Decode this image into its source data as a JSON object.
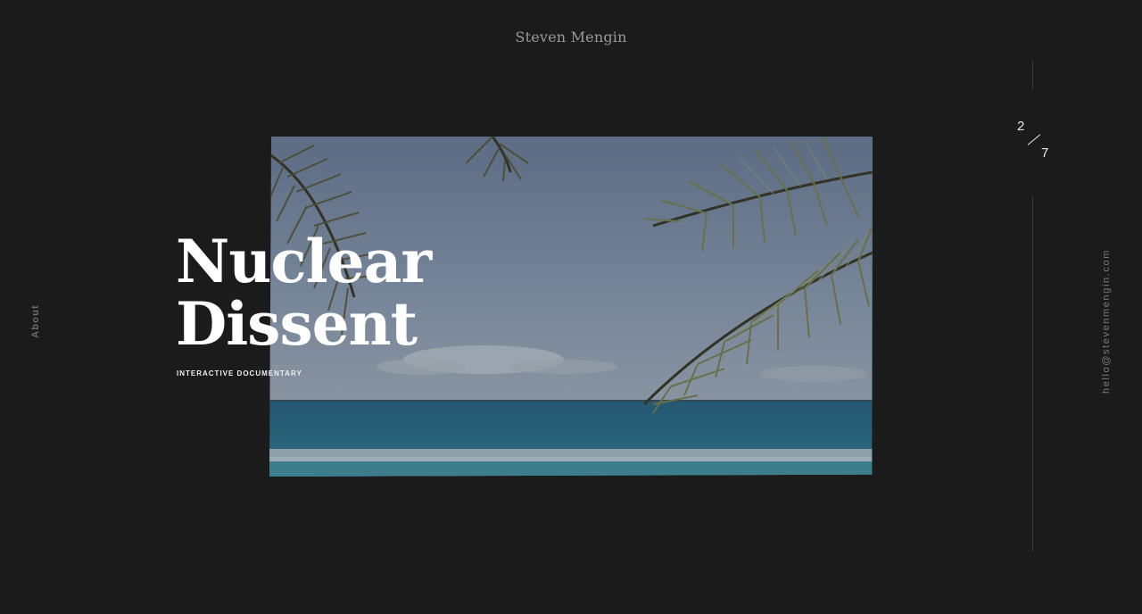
{
  "header": {
    "site_name": "Steven Mengin"
  },
  "side_nav": {
    "about_label": "About",
    "email_label": "hello@stevenmengin.com"
  },
  "pagination": {
    "current": "2",
    "total": "7"
  },
  "project": {
    "title_line1": "Nuclear",
    "title_line2": "Dissent",
    "type": "INTERACTIVE DOCUMENTARY",
    "image": "tropical beach with palm fronds"
  },
  "colors": {
    "background": "#1b1b1b",
    "title_text": "#ffffff",
    "muted_text": "#9a9a9a",
    "rail": "#3a3a3a"
  }
}
